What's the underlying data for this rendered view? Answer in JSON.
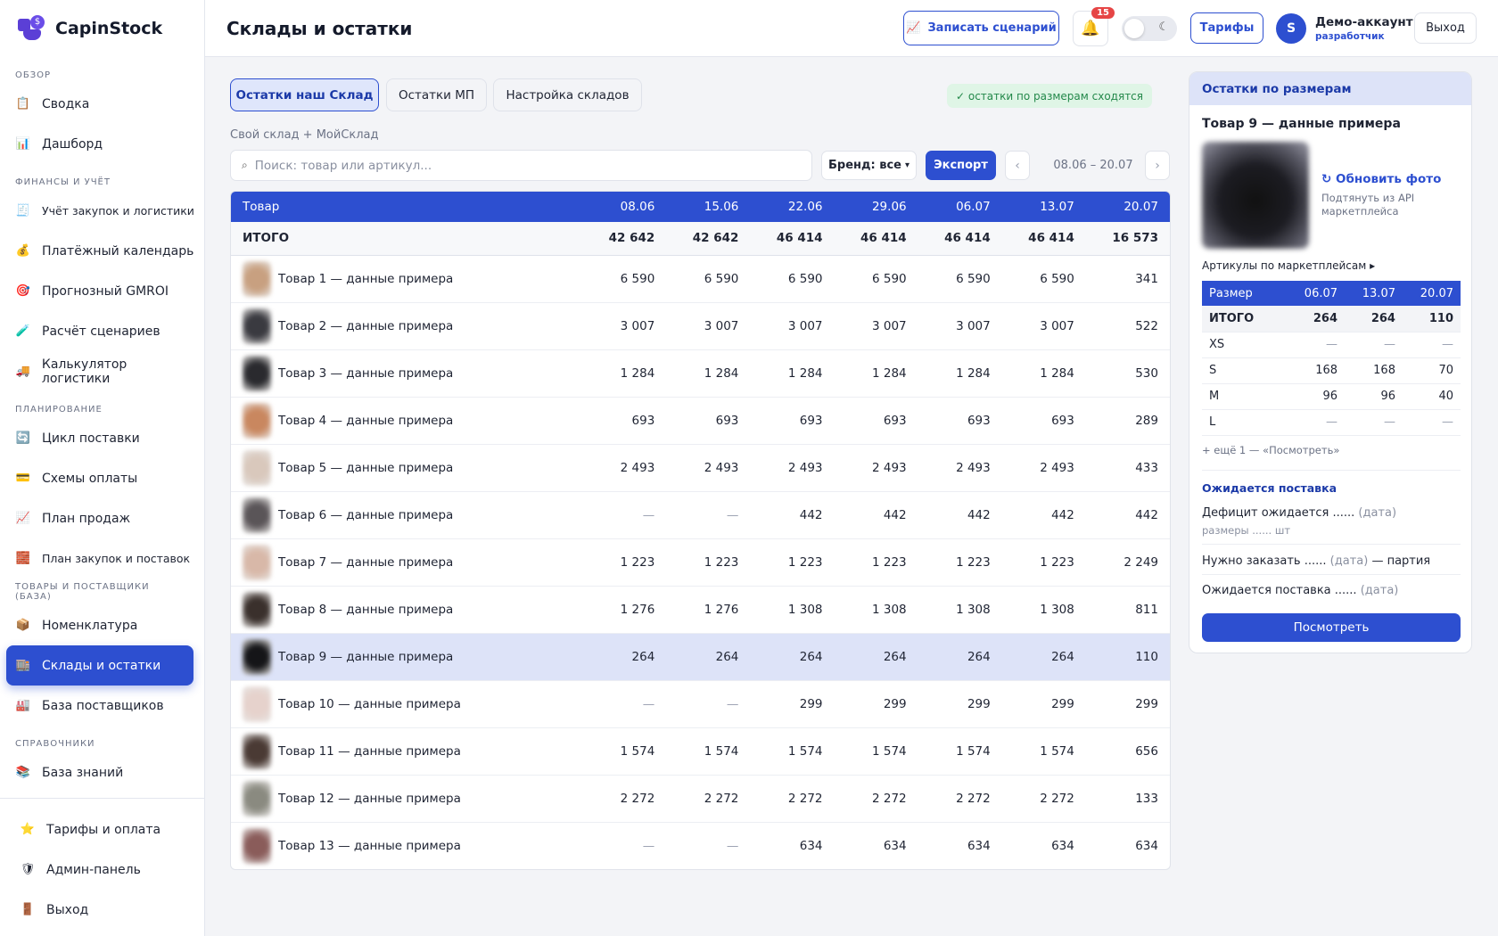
{
  "app": {
    "name": "CapinStock"
  },
  "sidebar": {
    "sections": [
      {
        "title": "ОБЗОР",
        "items": [
          {
            "label": "Сводка",
            "icon": "clipboard-icon",
            "glyph": "📋"
          },
          {
            "label": "Дашборд",
            "icon": "bar-chart-icon",
            "glyph": "📊"
          }
        ]
      },
      {
        "title": "ФИНАНСЫ И УЧЁТ",
        "items": [
          {
            "label": "Учёт закупок и логистики",
            "icon": "receipt-icon",
            "glyph": "🧾"
          },
          {
            "label": "Платёжный календарь",
            "icon": "money-bag-icon",
            "glyph": "💰"
          },
          {
            "label": "Прогнозный GMROI",
            "icon": "target-icon",
            "glyph": "🎯"
          },
          {
            "label": "Расчёт сценариев",
            "icon": "test-tube-icon",
            "glyph": "🧪"
          },
          {
            "label": "Калькулятор логистики",
            "icon": "truck-icon",
            "glyph": "🚚"
          }
        ]
      },
      {
        "title": "ПЛАНИРОВАНИЕ",
        "items": [
          {
            "label": "Цикл поставки",
            "icon": "cycle-icon",
            "glyph": "🔄"
          },
          {
            "label": "Схемы оплаты",
            "icon": "credit-card-icon",
            "glyph": "💳"
          },
          {
            "label": "План продаж",
            "icon": "trend-up-icon",
            "glyph": "📈"
          },
          {
            "label": "План закупок и поставок",
            "icon": "bricks-icon",
            "glyph": "🧱"
          }
        ]
      },
      {
        "title": "ТОВАРЫ И ПОСТАВЩИКИ (БАЗА)",
        "items": [
          {
            "label": "Номенклатура",
            "icon": "package-icon",
            "glyph": "📦"
          },
          {
            "label": "Склады и остатки",
            "icon": "warehouse-icon",
            "glyph": "🏬",
            "active": true
          },
          {
            "label": "База поставщиков",
            "icon": "factory-icon",
            "glyph": "🏭"
          }
        ]
      },
      {
        "title": "СПРАВОЧНИКИ",
        "items": [
          {
            "label": "База знаний",
            "icon": "books-icon",
            "glyph": "📚"
          }
        ]
      }
    ],
    "bottom": [
      {
        "label": "Тарифы и оплата",
        "icon": "star-icon",
        "glyph": "⭐"
      },
      {
        "label": "Админ-панель",
        "icon": "shield-icon",
        "glyph": "🛡"
      },
      {
        "label": "Выход",
        "icon": "door-icon",
        "glyph": "🚪"
      }
    ]
  },
  "topbar": {
    "title": "Склады и остатки",
    "record_label": "Записать сценарий",
    "notifications_count": "15",
    "tariffs_label": "Тарифы",
    "avatar_letter": "S",
    "account_name": "Демо-аккаунт",
    "account_role": "разработчик",
    "logout_label": "Выход"
  },
  "tabs": [
    "Остатки наш Склад",
    "Остатки МП",
    "Настройка складов"
  ],
  "status_badge": "✓ остатки по размерам сходятся",
  "subheading": "Свой склад + МойСклад",
  "filters": {
    "search_placeholder": "Поиск: товар или артикул...",
    "brand_label": "Бренд: все",
    "export_label": "Экспорт",
    "date_range": "08.06 – 20.07"
  },
  "table": {
    "product_header": "Товар",
    "dates": [
      "08.06",
      "15.06",
      "22.06",
      "29.06",
      "06.07",
      "13.07",
      "20.07"
    ],
    "total": {
      "label": "ИТОГО",
      "values": [
        "42 642",
        "42 642",
        "46 414",
        "46 414",
        "46 414",
        "46 414",
        "16 573"
      ]
    },
    "rows": [
      {
        "name": "Товар 1 — данные примера",
        "values": [
          "6 590",
          "6 590",
          "6 590",
          "6 590",
          "6 590",
          "6 590",
          "341"
        ],
        "thumb": "#c8a080"
      },
      {
        "name": "Товар 2 — данные примера",
        "values": [
          "3 007",
          "3 007",
          "3 007",
          "3 007",
          "3 007",
          "3 007",
          "522"
        ],
        "thumb": "#3a3a40"
      },
      {
        "name": "Товар 3 — данные примера",
        "values": [
          "1 284",
          "1 284",
          "1 284",
          "1 284",
          "1 284",
          "1 284",
          "530"
        ],
        "thumb": "#2a2a2e"
      },
      {
        "name": "Товар 4 — данные примера",
        "values": [
          "693",
          "693",
          "693",
          "693",
          "693",
          "693",
          "289"
        ],
        "thumb": "#c9875f"
      },
      {
        "name": "Товар 5 — данные примера",
        "values": [
          "2 493",
          "2 493",
          "2 493",
          "2 493",
          "2 493",
          "2 493",
          "433"
        ],
        "thumb": "#d9c8bc"
      },
      {
        "name": "Товар 6 — данные примера",
        "values": [
          "—",
          "—",
          "442",
          "442",
          "442",
          "442",
          "442"
        ],
        "thumb": "#5a5558"
      },
      {
        "name": "Товар 7 — данные примера",
        "values": [
          "1 223",
          "1 223",
          "1 223",
          "1 223",
          "1 223",
          "1 223",
          "2 249"
        ],
        "thumb": "#d8b8a8"
      },
      {
        "name": "Товар 8 — данные примера",
        "values": [
          "1 276",
          "1 276",
          "1 308",
          "1 308",
          "1 308",
          "1 308",
          "811"
        ],
        "thumb": "#3a302c"
      },
      {
        "name": "Товар 9 — данные примера",
        "values": [
          "264",
          "264",
          "264",
          "264",
          "264",
          "264",
          "110"
        ],
        "thumb": "#151518",
        "selected": true
      },
      {
        "name": "Товар 10 — данные примера",
        "values": [
          "—",
          "—",
          "299",
          "299",
          "299",
          "299",
          "299"
        ],
        "thumb": "#e6d2cc"
      },
      {
        "name": "Товар 11 — данные примера",
        "values": [
          "1 574",
          "1 574",
          "1 574",
          "1 574",
          "1 574",
          "1 574",
          "656"
        ],
        "thumb": "#4a3a34"
      },
      {
        "name": "Товар 12 — данные примера",
        "values": [
          "2 272",
          "2 272",
          "2 272",
          "2 272",
          "2 272",
          "2 272",
          "133"
        ],
        "thumb": "#8a8a80"
      },
      {
        "name": "Товар 13 — данные примера",
        "values": [
          "—",
          "—",
          "634",
          "634",
          "634",
          "634",
          "634"
        ],
        "thumb": "#8a5c5a"
      }
    ]
  },
  "panel": {
    "title": "Остатки по размерам",
    "product": "Товар 9 — данные примера",
    "refresh_photo": "↻ Обновить фото",
    "photo_hint": "Подтянуть из API маркетплейса",
    "mp_articles": "Артикулы по маркетплейсам ▸",
    "size_header": "Размер",
    "size_dates": [
      "06.07",
      "13.07",
      "20.07"
    ],
    "size_total": {
      "label": "ИТОГО",
      "values": [
        "264",
        "264",
        "110"
      ]
    },
    "sizes": [
      {
        "size": "XS",
        "values": [
          "—",
          "—",
          "—"
        ]
      },
      {
        "size": "S",
        "values": [
          "168",
          "168",
          "70"
        ]
      },
      {
        "size": "M",
        "values": [
          "96",
          "96",
          "40"
        ]
      },
      {
        "size": "L",
        "values": [
          "—",
          "—",
          "—"
        ]
      }
    ],
    "more": "+ ещё 1 — «Посмотреть»",
    "expected_title": "Ожидается поставка",
    "deficit_label": "Дефицит ожидается ......",
    "deficit_date": "(дата)",
    "deficit_sub": "размеры ...... шт",
    "order_label": "Нужно заказать ......",
    "order_date": "(дата)",
    "order_suffix": "— партия",
    "expected_label": "Ожидается поставка ......",
    "expected_date": "(дата)",
    "view_button": "Посмотреть"
  }
}
